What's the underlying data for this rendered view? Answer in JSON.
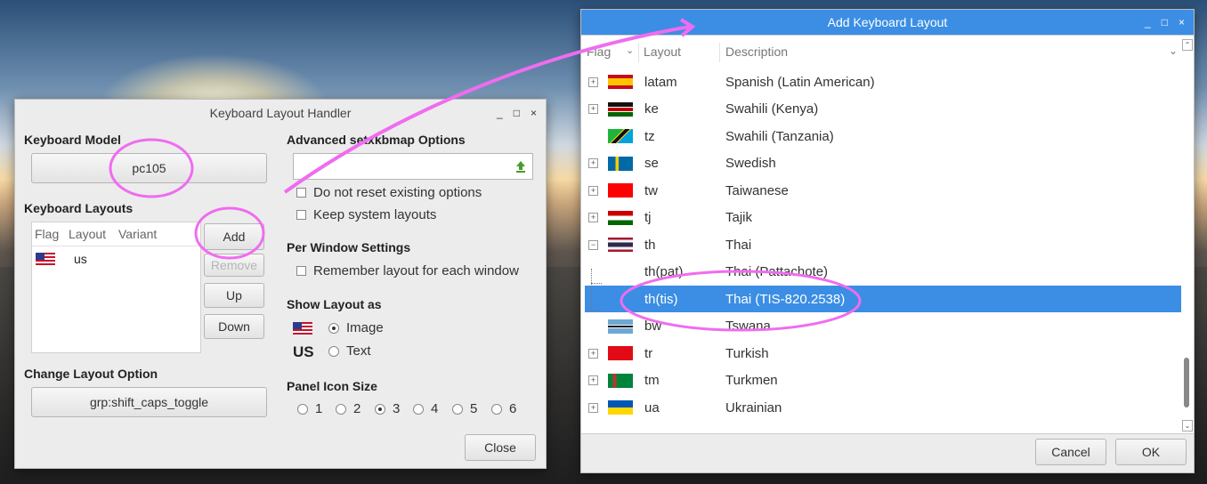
{
  "handler": {
    "title": "Keyboard Layout Handler",
    "window_controls": [
      "_",
      "□",
      "×"
    ],
    "keyboard_model_label": "Keyboard Model",
    "keyboard_model_value": "pc105",
    "keyboard_layouts_label": "Keyboard Layouts",
    "table_headers": [
      "Flag",
      "Layout",
      "Variant"
    ],
    "layouts": [
      {
        "layout": "us",
        "variant": ""
      }
    ],
    "add_label": "Add",
    "remove_label": "Remove",
    "up_label": "Up",
    "down_label": "Down",
    "change_option_label": "Change Layout Option",
    "change_option_value": "grp:shift_caps_toggle",
    "advanced_label": "Advanced setxkbmap Options",
    "advanced_value": "",
    "no_reset_label": "Do not reset existing options",
    "keep_system_label": "Keep system layouts",
    "per_window_label": "Per Window Settings",
    "remember_label": "Remember layout for each window",
    "show_as_label": "Show Layout as",
    "image_label": "Image",
    "text_flag": "US",
    "text_label": "Text",
    "show_as_selected": "Image",
    "panel_icon_label": "Panel Icon Size",
    "icon_sizes": [
      "1",
      "2",
      "3",
      "4",
      "5",
      "6"
    ],
    "icon_size_selected": "3",
    "close_label": "Close"
  },
  "add_dialog": {
    "title": "Add Keyboard Layout",
    "window_controls": [
      "_",
      "□",
      "×"
    ],
    "headers": {
      "flag": "Flag",
      "layout": "Layout",
      "description": "Description"
    },
    "rows": [
      {
        "code": "latam",
        "desc": "Spanish (Latin American)",
        "expander": "+",
        "flag": "es"
      },
      {
        "code": "ke",
        "desc": "Swahili (Kenya)",
        "expander": "+",
        "flag": "ke"
      },
      {
        "code": "tz",
        "desc": "Swahili (Tanzania)",
        "expander": "",
        "flag": "tz"
      },
      {
        "code": "se",
        "desc": "Swedish",
        "expander": "+",
        "flag": "se"
      },
      {
        "code": "tw",
        "desc": "Taiwanese",
        "expander": "+",
        "flag": "tw"
      },
      {
        "code": "tj",
        "desc": "Tajik",
        "expander": "+",
        "flag": "tj"
      },
      {
        "code": "th",
        "desc": "Thai",
        "expander": "−",
        "flag": "th"
      },
      {
        "code": "th(pat)",
        "desc": "Thai (Pattachote)",
        "expander": "",
        "flag": ""
      },
      {
        "code": "th(tis)",
        "desc": "Thai (TIS-820.2538)",
        "expander": "",
        "flag": "",
        "selected": true
      },
      {
        "code": "bw",
        "desc": "Tswana",
        "expander": "",
        "flag": "bw"
      },
      {
        "code": "tr",
        "desc": "Turkish",
        "expander": "+",
        "flag": "tr"
      },
      {
        "code": "tm",
        "desc": "Turkmen",
        "expander": "+",
        "flag": "tm"
      },
      {
        "code": "ua",
        "desc": "Ukrainian",
        "expander": "+",
        "flag": "ua"
      }
    ],
    "cancel_label": "Cancel",
    "ok_label": "OK"
  },
  "colors": {
    "selection": "#3b8ee4",
    "dialog_titlebar": "#3b8ee4",
    "annotation": "#f06cf0"
  }
}
